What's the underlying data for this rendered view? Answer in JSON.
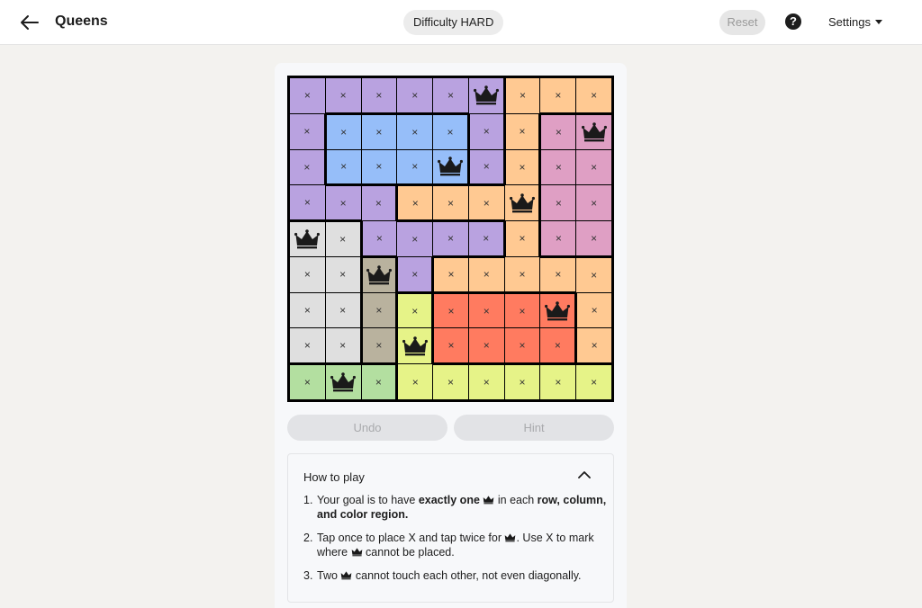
{
  "header": {
    "title": "Queens",
    "difficulty": "Difficulty HARD",
    "reset_label": "Reset",
    "help_label": "?",
    "settings_label": "Settings"
  },
  "colors": {
    "purple": "#b9a2e0",
    "blue": "#96bef9",
    "orange": "#ffc992",
    "pink": "#df9fc4",
    "grey": "#dfdfdf",
    "tan": "#b9b29e",
    "yellow": "#e6f388",
    "red": "#ff7b60",
    "green": "#b3dfa0"
  },
  "board": {
    "size": 9,
    "mark_symbol": "×",
    "queen_icon": "crown-icon",
    "regions": [
      [
        "purple",
        "purple",
        "purple",
        "purple",
        "purple",
        "purple",
        "orange",
        "orange",
        "orange"
      ],
      [
        "purple",
        "blue",
        "blue",
        "blue",
        "blue",
        "purple",
        "orange",
        "pink",
        "pink"
      ],
      [
        "purple",
        "blue",
        "blue",
        "blue",
        "blue",
        "purple",
        "orange",
        "pink",
        "pink"
      ],
      [
        "purple",
        "purple",
        "purple",
        "orange",
        "orange",
        "orange",
        "orange",
        "pink",
        "pink"
      ],
      [
        "grey",
        "grey",
        "purple",
        "purple",
        "purple",
        "purple",
        "orange",
        "pink",
        "pink"
      ],
      [
        "grey",
        "grey",
        "tan",
        "purple",
        "orange",
        "orange",
        "orange",
        "orange",
        "orange"
      ],
      [
        "grey",
        "grey",
        "tan",
        "yellow",
        "red",
        "red",
        "red",
        "red",
        "orange"
      ],
      [
        "grey",
        "grey",
        "tan",
        "yellow",
        "red",
        "red",
        "red",
        "red",
        "orange"
      ],
      [
        "green",
        "green",
        "green",
        "yellow",
        "yellow",
        "yellow",
        "yellow",
        "yellow",
        "yellow"
      ]
    ],
    "queens": [
      [
        0,
        5
      ],
      [
        1,
        8
      ],
      [
        2,
        4
      ],
      [
        3,
        6
      ],
      [
        4,
        0
      ],
      [
        5,
        2
      ],
      [
        6,
        7
      ],
      [
        7,
        3
      ],
      [
        8,
        1
      ]
    ]
  },
  "controls": {
    "undo_label": "Undo",
    "hint_label": "Hint"
  },
  "how_to_play": {
    "title": "How to play",
    "rules": [
      {
        "num": "1.",
        "html": "Your goal is to have <b>exactly one</b> {Q} in each <b>row, column, and color region.</b>"
      },
      {
        "num": "2.",
        "html": "Tap once to place X and tap twice for {Q}. Use X to mark where {Q} cannot be placed."
      },
      {
        "num": "3.",
        "html": "Two {Q} cannot touch each other, not even diagonally."
      }
    ]
  }
}
